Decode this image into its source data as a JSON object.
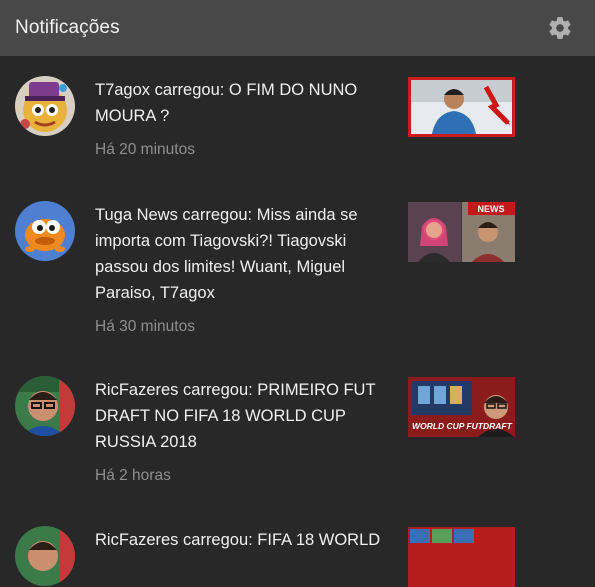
{
  "header": {
    "title": "Notificações",
    "settings_icon": "gear-icon"
  },
  "notifications": [
    {
      "message": "T7agox carregou: O FIM DO NUNO MOURA ?",
      "time": "Há 20 minutos"
    },
    {
      "message": "Tuga News carregou: Miss ainda se importa com Tiagovski?! Tiagovski passou dos limites! Wuant, Miguel Paraiso, T7agox",
      "time": "Há 30 minutos",
      "thumb_text": "NEWS"
    },
    {
      "message": "RicFazeres carregou: PRIMEIRO FUT DRAFT NO FIFA 18 WORLD CUP RUSSIA 2018",
      "time": "Há 2 horas",
      "thumb_text": "WORLD CUP FUTDRAFT"
    },
    {
      "message": "RicFazeres carregou: FIFA 18 WORLD",
      "time": ""
    }
  ],
  "colors": {
    "background": "#282828",
    "header": "#484848",
    "accent_red": "#cc0000"
  }
}
